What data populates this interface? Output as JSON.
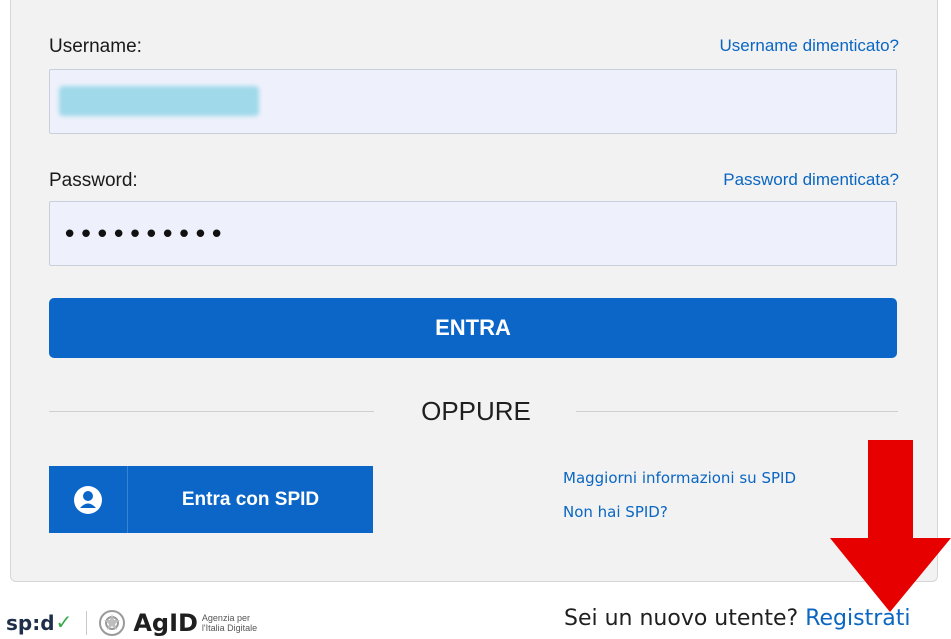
{
  "login": {
    "username_label": "Username:",
    "username_forgot": "Username dimenticato?",
    "username_value": "",
    "password_label": "Password:",
    "password_forgot": "Password dimenticata?",
    "password_masked": "••••••••••",
    "submit_label": "ENTRA",
    "or_label": "OPPURE"
  },
  "spid": {
    "button_label": "Entra con SPID",
    "more_info_link": "Maggiorni informazioni su SPID",
    "no_spid_link": "Non hai SPID?"
  },
  "footer": {
    "spid_logo": "sp:d",
    "agid_logo": "AgID",
    "agid_subtitle": "Agenzia per l'Italia Digitale",
    "register_prompt": "Sei un nuovo utente?",
    "register_link": "Registrati"
  },
  "colors": {
    "primary": "#0b66c8",
    "link": "#0a66c2",
    "annotation_arrow": "#e60000"
  }
}
